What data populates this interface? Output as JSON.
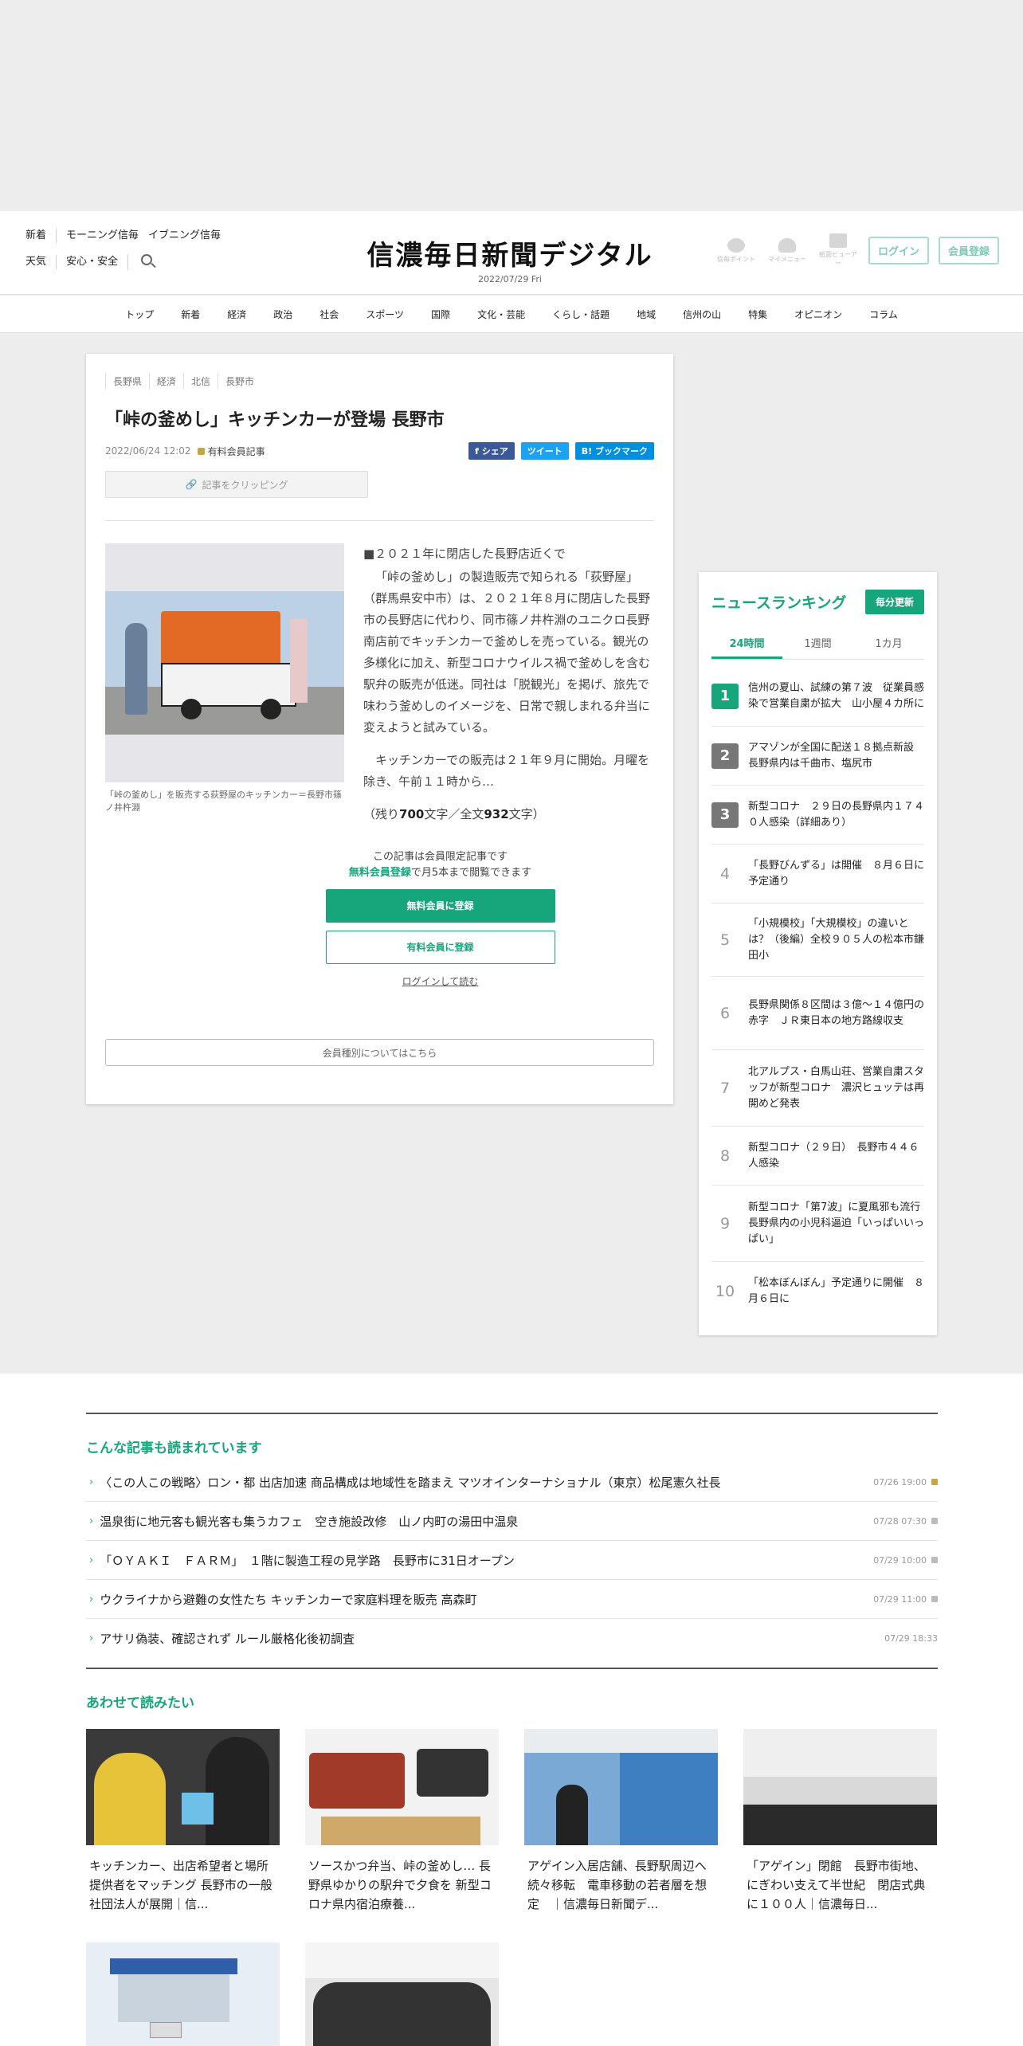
{
  "header": {
    "left_row1": [
      "新着",
      "モーニング信毎",
      "イブニング信毎"
    ],
    "left_row2": [
      "天気",
      "安心・安全"
    ],
    "logo": "信濃毎日新聞デジタル",
    "date": "2022/07/29 Fri",
    "icons": [
      "信毎ポイント",
      "マイメニュー",
      "紙面ビューアー"
    ],
    "login": "ログイン",
    "register": "会員登録"
  },
  "nav": [
    "トップ",
    "新着",
    "経済",
    "政治",
    "社会",
    "スポーツ",
    "国際",
    "文化・芸能",
    "くらし・話題",
    "地域",
    "信州の山",
    "特集",
    "オピニオン",
    "コラム"
  ],
  "article": {
    "tags": [
      "長野県",
      "経済",
      "北信",
      "長野市"
    ],
    "title": "「峠の釜めし」キッチンカーが登場 長野市",
    "datetime": "2022/06/24 12:02",
    "member_label": "有料会員記事",
    "share": {
      "facebook": "f シェア",
      "twitter": "ツイート",
      "hatena": "B! ブックマーク"
    },
    "clip": "記事をクリッピング",
    "photo_caption": "「峠の釜めし」を販売する荻野屋のキッチンカー＝長野市篠ノ井杵淵",
    "subhead": "■２０２１年に閉店した長野店近くで",
    "para1": "「峠の釜めし」の製造販売で知られる「荻野屋」（群馬県安中市）は、２０２１年８月に閉店した長野市の長野店に代わり、同市篠ノ井杵淵のユニクロ長野南店前でキッチンカーで釜めしを売っている。観光の多様化に加え、新型コロナウイルス禍で釜めしを含む駅弁の販売が低迷。同社は「脱観光」を掲げ、旅先で味わう釜めしのイメージを、日常で親しまれる弁当に変えようと試みている。",
    "para2": "キッチンカーでの販売は２１年９月に開始。月曜を除き、午前１１時から…",
    "remaining_prefix": "（残り",
    "remaining_chars": "700",
    "remaining_mid": "文字／全文",
    "total_chars": "932",
    "remaining_suffix": "文字）",
    "paywall_line1": "この記事は会員限定記事です",
    "paywall_free_link": "無料会員登録",
    "paywall_line2": "で月5本まで閲覧できます",
    "btn_free": "無料会員に登録",
    "btn_paid": "有料会員に登録",
    "login_link": "ログインして読む",
    "member_types": "会員種別についてはこちら"
  },
  "ranking": {
    "title": "ニュースランキング",
    "update": "毎分更新",
    "tabs": [
      "24時間",
      "1週間",
      "1カ月"
    ],
    "items": [
      "信州の夏山、試練の第７波　従業員感染で営業自粛が拡大　山小屋４カ所に",
      "アマゾンが全国に配送１８拠点新設　長野県内は千曲市、塩尻市",
      "新型コロナ　２９日の長野県内１７４０人感染（詳細あり）",
      "「長野びんずる」は開催　８月６日に予定通り",
      "「小規模校」「大規模校」の違いとは？（後編）全校９０５人の松本市鎌田小",
      "長野県関係８区間は３億～１４億円の赤字　ＪＲ東日本の地方路線収支",
      "北アルプス・白馬山荘、営業自粛スタッフが新型コロナ　濃沢ヒュッテは再開めど発表",
      "新型コロナ（２９日）　長野市４４６人感染",
      "新型コロナ「第7波」に夏風邪も流行　長野県内の小児科逼迫「いっぱいいっぱい」",
      "「松本ぼんぼん」予定通りに開催　８月６日に"
    ]
  },
  "related": {
    "heading": "こんな記事も読まれています",
    "items": [
      {
        "title": "〈この人この戦略〉ロン・都 出店加速 商品構成は地域性を踏まえ マツオインターナショナル（東京）松尾憲久社長",
        "date": "07/26 19:00"
      },
      {
        "title": "温泉街に地元客も観光客も集うカフェ　空き施設改修　山ノ内町の湯田中温泉",
        "date": "07/28 07:30"
      },
      {
        "title": "「ＯＹＡＫＩ　ＦＡＲＭ」　１階に製造工程の見学路　長野市に31日オープン",
        "date": "07/29 10:00"
      },
      {
        "title": "ウクライナから避難の女性たち キッチンカーで家庭料理を販売 高森町",
        "date": "07/29 11:00"
      },
      {
        "title": "アサリ偽装、確認されず ルール厳格化後初調査",
        "date": "07/29 18:33"
      }
    ]
  },
  "recommend": {
    "heading": "あわせて読みたい",
    "items": [
      "キッチンカー、出店希望者と場所提供者をマッチング 長野市の一般社団法人が展開｜信...",
      "ソースかつ弁当、峠の釜めし… 長野県ゆかりの駅弁で夕食を 新型コロナ県内宿泊療養...",
      "アゲイン入居店舗、長野駅周辺へ続々移転　電車移動の若者層を想定　｜信濃毎日新聞デ...",
      "「アゲイン」閉館　長野市街地、にぎわい支えて半世紀　閉店式典に１００人｜信濃毎日..."
    ]
  },
  "colors": {
    "accent": "#17a67c",
    "lock": "#c5a645"
  }
}
